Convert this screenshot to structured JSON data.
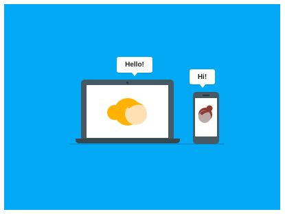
{
  "illustration": {
    "laptop_bubble": "Hello!",
    "phone_bubble": "Hi!"
  },
  "colors": {
    "background": "#03A9F4",
    "device_body": "#455A64",
    "bubble": "#FFFFFF",
    "avatar_laptop_hair": "#FFB300",
    "avatar_laptop_face": "#FFE0B2",
    "avatar_phone_hair": "#8D3A32",
    "avatar_phone_face": "#BCAAA4"
  },
  "icons": [
    "laptop-icon",
    "phone-icon",
    "woman-avatar-icon",
    "girl-avatar-icon"
  ]
}
